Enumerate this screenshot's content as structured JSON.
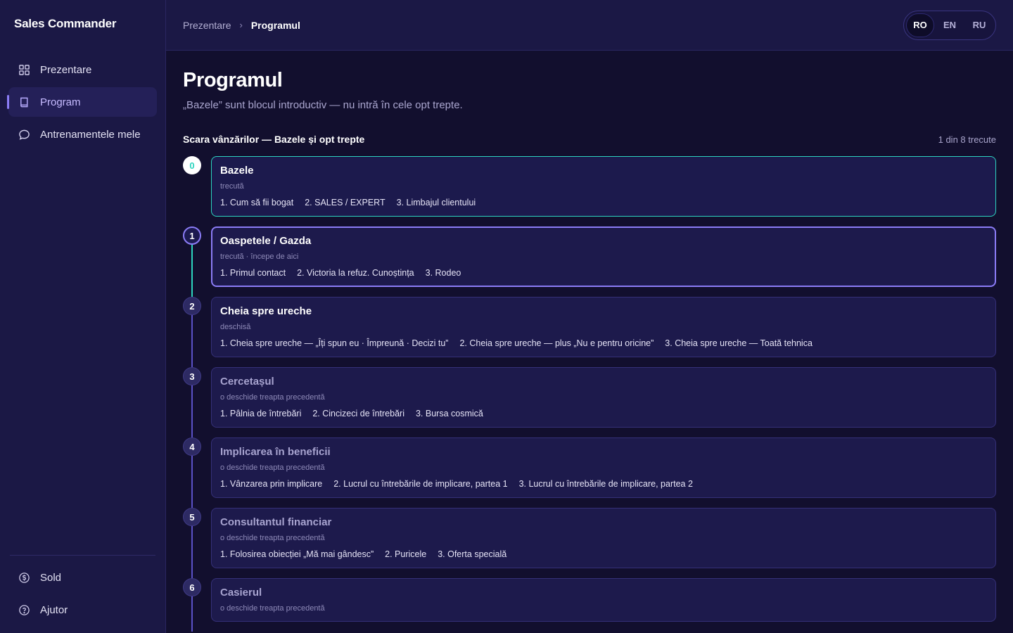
{
  "app": {
    "name": "Sales Commander"
  },
  "sidebar": {
    "items": [
      {
        "label": "Prezentare",
        "icon": "grid-icon"
      },
      {
        "label": "Program",
        "icon": "book-icon"
      },
      {
        "label": "Antrenamentele mele",
        "icon": "chat-bubble-icon"
      }
    ],
    "bottom": [
      {
        "label": "Sold",
        "icon": "dollar-circle-icon"
      },
      {
        "label": "Ajutor",
        "icon": "help-circle-icon"
      }
    ]
  },
  "topbar": {
    "breadcrumb": {
      "parent": "Prezentare",
      "separator": "›",
      "current": "Programul"
    },
    "languages": [
      "RO",
      "EN",
      "RU"
    ],
    "active_language": "RO"
  },
  "page": {
    "title": "Programul",
    "subtitle": "„Bazele” sunt blocul introductiv — nu intră în cele opt trepte."
  },
  "section": {
    "title": "Scara vânzărilor — Bazele și opt trepte",
    "progress": "1 din 8 trecute"
  },
  "steps": [
    {
      "number": "0",
      "state": "done",
      "title": "Bazele",
      "status": "trecută",
      "lessons": [
        "1. Cum să fii bogat",
        "2. SALES / EXPERT",
        "3. Limbajul clientului"
      ]
    },
    {
      "number": "1",
      "state": "current",
      "title": "Oaspetele / Gazda",
      "status": "trecută · începe de aici",
      "lessons": [
        "1. Primul contact",
        "2. Victoria la refuz. Cunoștința",
        "3. Rodeo"
      ]
    },
    {
      "number": "2",
      "state": "open",
      "title": "Cheia spre ureche",
      "status": "deschisă",
      "lessons": [
        "1. Cheia spre ureche — „Îți spun eu · Împreună · Decizi tu”",
        "2. Cheia spre ureche — plus „Nu e pentru oricine”",
        "3. Cheia spre ureche — Toată tehnica"
      ]
    },
    {
      "number": "3",
      "state": "locked",
      "title": "Cercetașul",
      "status": "o deschide treapta precedentă",
      "lessons": [
        "1. Pâlnia de întrebări",
        "2. Cincizeci de întrebări",
        "3. Bursa cosmică"
      ]
    },
    {
      "number": "4",
      "state": "locked",
      "title": "Implicarea în beneficii",
      "status": "o deschide treapta precedentă",
      "lessons": [
        "1. Vânzarea prin implicare",
        "2. Lucrul cu întrebările de implicare, partea 1",
        "3. Lucrul cu întrebările de implicare, partea 2"
      ]
    },
    {
      "number": "5",
      "state": "locked",
      "title": "Consultantul financiar",
      "status": "o deschide treapta precedentă",
      "lessons": [
        "1. Folosirea obiecției „Mă mai gândesc”",
        "2. Puricele",
        "3. Oferta specială"
      ]
    },
    {
      "number": "6",
      "state": "locked",
      "title": "Casierul",
      "status": "o deschide treapta precedentă",
      "lessons": []
    }
  ],
  "colors": {
    "accent": "#8b7cf6",
    "done": "#2dd4bf",
    "background": "#120f2e",
    "sidebar": "#1b1845"
  }
}
